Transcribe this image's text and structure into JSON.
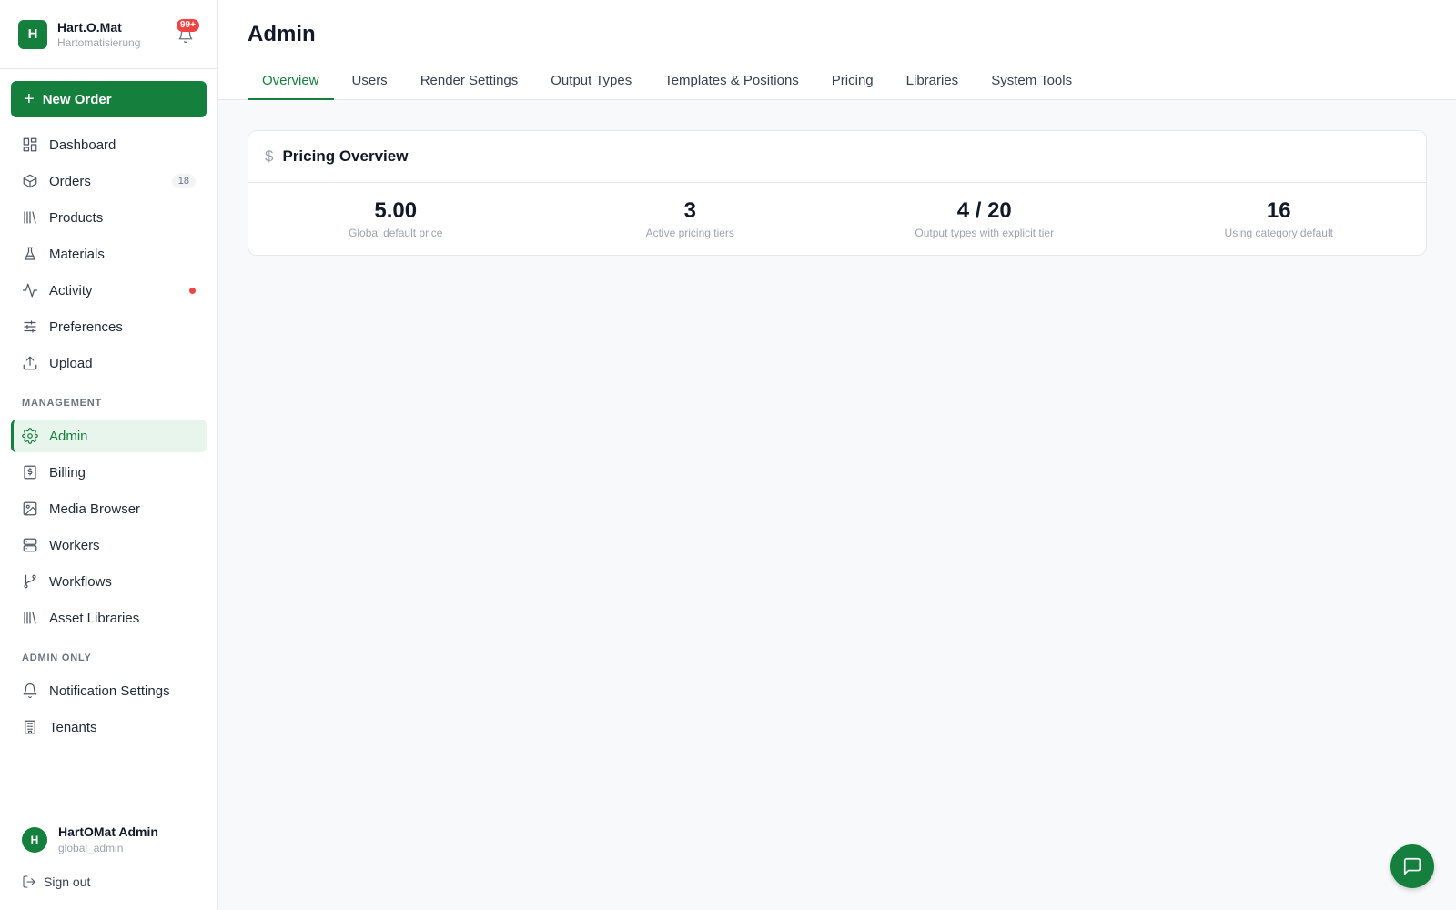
{
  "brand": {
    "initial": "H",
    "name": "Hart.O.Mat",
    "subtitle": "Hartomatisierung",
    "notifications": "99+"
  },
  "sidebar": {
    "new_order": "New Order",
    "items": [
      {
        "label": "Dashboard",
        "icon": "dashboard-icon"
      },
      {
        "label": "Orders",
        "icon": "box-icon",
        "badge": "18"
      },
      {
        "label": "Products",
        "icon": "library-icon"
      },
      {
        "label": "Materials",
        "icon": "flask-icon"
      },
      {
        "label": "Activity",
        "icon": "activity-icon"
      },
      {
        "label": "Preferences",
        "icon": "sliders-icon"
      },
      {
        "label": "Upload",
        "icon": "upload-icon"
      }
    ],
    "management_label": "MANAGEMENT",
    "management": [
      {
        "label": "Admin",
        "icon": "gear-icon"
      },
      {
        "label": "Billing",
        "icon": "receipt-icon"
      },
      {
        "label": "Media Browser",
        "icon": "image-icon"
      },
      {
        "label": "Workers",
        "icon": "server-icon"
      },
      {
        "label": "Workflows",
        "icon": "git-branch-icon"
      },
      {
        "label": "Asset Libraries",
        "icon": "library-icon"
      }
    ],
    "admin_only_label": "ADMIN ONLY",
    "admin_only": [
      {
        "label": "Notification Settings",
        "icon": "bell-icon"
      },
      {
        "label": "Tenants",
        "icon": "building-icon"
      }
    ]
  },
  "user": {
    "initial": "H",
    "name": "HartOMat Admin",
    "role": "global_admin",
    "signout": "Sign out"
  },
  "header": {
    "title": "Admin",
    "tabs": [
      "Overview",
      "Users",
      "Render Settings",
      "Output Types",
      "Templates & Positions",
      "Pricing",
      "Libraries",
      "System Tools"
    ]
  },
  "pricing": {
    "title": "Pricing Overview",
    "stats": [
      {
        "value": "5.00",
        "label": "Global default price"
      },
      {
        "value": "3",
        "label": "Active pricing tiers"
      },
      {
        "value": "4 / 20",
        "label": "Output types with explicit tier"
      },
      {
        "value": "16",
        "label": "Using category default"
      }
    ]
  },
  "colors": {
    "accent": "#15803d",
    "active_bg": "#e8f5ec",
    "alert": "#ef4444"
  }
}
